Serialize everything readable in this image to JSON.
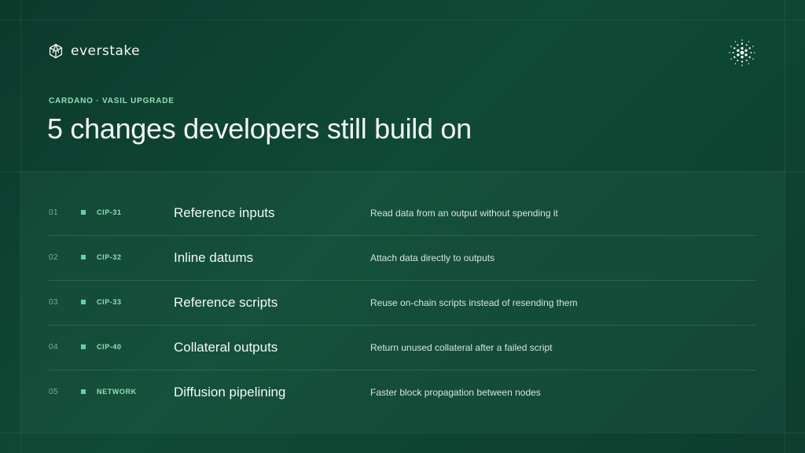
{
  "brand": {
    "name": "everstake",
    "logo_icon": "everstake-hexagon-icon",
    "partner_icon": "cardano-icon"
  },
  "header": {
    "eyebrow": "CARDANO · VASIL UPGRADE",
    "title": "5 changes developers still build on"
  },
  "colors": {
    "background": "#0f4a36",
    "accent": "#5fd49a",
    "text": "#f3f8f5"
  },
  "rows": [
    {
      "num": "01",
      "tag": "CIP-31",
      "name": "Reference inputs",
      "desc": "Read data from an output without spending it"
    },
    {
      "num": "02",
      "tag": "CIP-32",
      "name": "Inline datums",
      "desc": "Attach data directly to outputs"
    },
    {
      "num": "03",
      "tag": "CIP-33",
      "name": "Reference scripts",
      "desc": "Reuse on-chain scripts instead of resending them"
    },
    {
      "num": "04",
      "tag": "CIP-40",
      "name": "Collateral outputs",
      "desc": "Return unused collateral after a failed script"
    },
    {
      "num": "05",
      "tag": "NETWORK",
      "name": "Diffusion pipelining",
      "desc": "Faster block propagation between nodes"
    }
  ]
}
